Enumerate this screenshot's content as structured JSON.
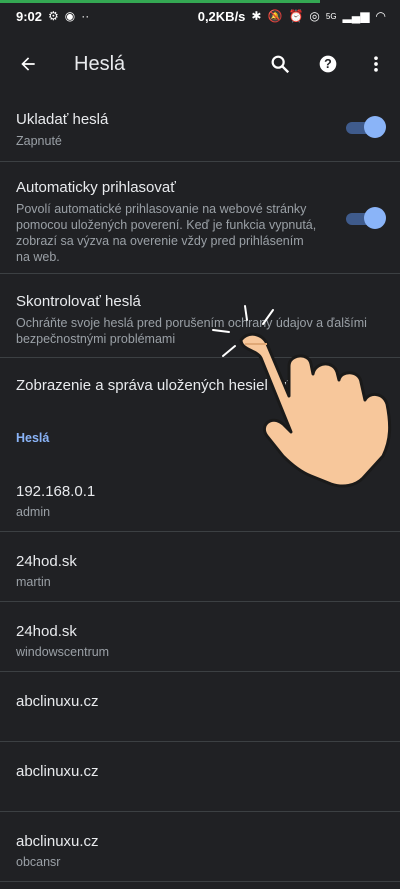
{
  "status": {
    "time": "9:02",
    "data_speed": "0,2KB/s",
    "network": "5G"
  },
  "appbar": {
    "title": "Heslá",
    "icons": {
      "back": "arrow-back-icon",
      "search": "search-icon",
      "help": "help-icon",
      "more": "more-vert-icon"
    }
  },
  "settings": {
    "save": {
      "title": "Ukladať heslá",
      "subtitle": "Zapnuté",
      "enabled": true
    },
    "autologin": {
      "title": "Automaticky prihlasovať",
      "subtitle": "Povolí automatické prihlasovanie na webové stránky pomocou uložených poverení. Keď je funkcia vypnutá, zobrazí sa výzva na overenie vždy pred prihlásením na web.",
      "enabled": true
    },
    "check": {
      "title": "Skontrolovať heslá",
      "subtitle": "Ochráňte svoje heslá pred porušením ochrany údajov a ďalšími bezpečnostnými problémami"
    },
    "manage": {
      "title": "Zobrazenie a správa uložených hesiel v ú"
    }
  },
  "passwords": {
    "header": "Heslá",
    "items": [
      {
        "site": "192.168.0.1",
        "user": "admin"
      },
      {
        "site": "24hod.sk",
        "user": "martin"
      },
      {
        "site": "24hod.sk",
        "user": "windowscentrum"
      },
      {
        "site": "abclinuxu.cz",
        "user": ""
      },
      {
        "site": "abclinuxu.cz",
        "user": ""
      },
      {
        "site": "abclinuxu.cz",
        "user": "obcansr"
      }
    ]
  },
  "colors": {
    "background": "#202124",
    "accent": "#8ab4f8",
    "divider": "#3c4043"
  }
}
